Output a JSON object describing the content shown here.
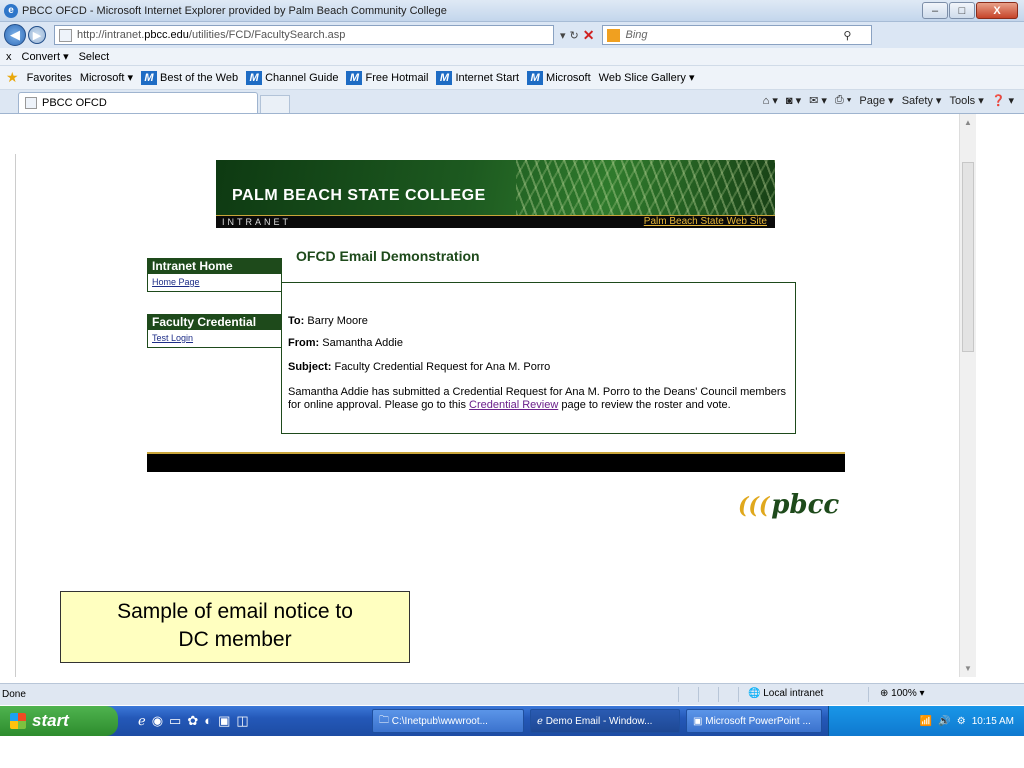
{
  "window": {
    "title": "PBCC OFCD - Microsoft Internet Explorer provided by Palm Beach Community College",
    "minimize": "–",
    "maximize": "□",
    "close": "X"
  },
  "address": {
    "url_prefix": "http://intranet.",
    "url_domain": "pbcc.edu",
    "url_suffix": "/utilities/FCD/FacultySearch.asp",
    "search_placeholder": "Bing"
  },
  "commandbar": {
    "convert": "Convert ▾",
    "select": "Select"
  },
  "favorites": {
    "label": "Favorites",
    "items": [
      "Microsoft ▾",
      "Best of the Web",
      "Channel Guide",
      "Free Hotmail",
      "Internet Start",
      "Microsoft",
      "Web Slice Gallery ▾"
    ]
  },
  "tab": {
    "label": "PBCC OFCD"
  },
  "tab_tools": {
    "page": "Page ▾",
    "safety": "Safety ▾",
    "tools": "Tools ▾"
  },
  "banner": {
    "title": "PALM BEACH STATE COLLEGE",
    "subtitle": "INTRANET",
    "site_link": "Palm Beach State Web Site"
  },
  "sidebar": [
    {
      "header": "Intranet Home",
      "link": "Home Page"
    },
    {
      "header": "Faculty Credential",
      "link": "Test Login"
    }
  ],
  "page": {
    "title": "OFCD Email Demonstration"
  },
  "email": {
    "to_label": "To:",
    "to_value": "Barry Moore",
    "from_label": "From:",
    "from_value": "Samantha Addie",
    "subject_label": "Subject:",
    "subject_value": "Faculty Credential Request for Ana M. Porro",
    "body_before": "Samantha Addie has submitted a Credential Request for Ana M. Porro to the Deans' Council members for online approval. Please go to this ",
    "body_link": "Credential Review",
    "body_after": " page to review the roster and vote."
  },
  "logo": {
    "text": "pbcc"
  },
  "callout": {
    "line1": "Sample of email notice to",
    "line2": "DC member"
  },
  "status": {
    "text": "Done",
    "zone": "Local intranet",
    "zoom": "100%"
  },
  "taskbar": {
    "start": "start",
    "items": [
      "C:\\Inetpub\\wwwroot...",
      "Demo Email - Window...",
      "Microsoft PowerPoint ..."
    ],
    "clock": "10:15 AM"
  }
}
